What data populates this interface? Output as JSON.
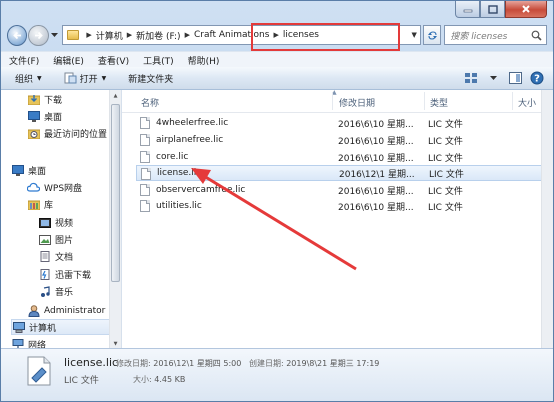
{
  "address": {
    "segments": [
      "计算机",
      "新加卷 (F:)",
      "Craft Animations",
      "licenses"
    ]
  },
  "search": {
    "placeholder": "搜索 licenses"
  },
  "menu": [
    "文件(F)",
    "编辑(E)",
    "查看(V)",
    "工具(T)",
    "帮助(H)"
  ],
  "toolbar": {
    "organize": "组织",
    "open": "打开",
    "new_folder": "新建文件夹"
  },
  "nav": {
    "favorites": [
      {
        "label": "下载",
        "icon": "download-folder-icon"
      },
      {
        "label": "桌面",
        "icon": "desktop-icon"
      },
      {
        "label": "最近访问的位置",
        "icon": "recent-places-icon"
      }
    ],
    "items": [
      {
        "label": "桌面",
        "icon": "desktop-icon"
      },
      {
        "label": "WPS网盘",
        "icon": "cloud-icon"
      },
      {
        "label": "库",
        "icon": "library-icon"
      },
      {
        "label": "视频",
        "icon": "video-library-icon"
      },
      {
        "label": "图片",
        "icon": "pictures-library-icon"
      },
      {
        "label": "文档",
        "icon": "documents-library-icon"
      },
      {
        "label": "迅雷下载",
        "icon": "thunder-download-icon"
      },
      {
        "label": "音乐",
        "icon": "music-library-icon"
      },
      {
        "label": "Administrator",
        "icon": "user-icon"
      },
      {
        "label": "计算机",
        "icon": "computer-icon"
      },
      {
        "label": "网络",
        "icon": "network-icon"
      }
    ]
  },
  "columns": {
    "name": "名称",
    "date": "修改日期",
    "type": "类型",
    "size": "大小"
  },
  "files": [
    {
      "name": "4wheelerfree.lic",
      "date": "2016\\6\\10 星期...",
      "type": "LIC 文件"
    },
    {
      "name": "airplanefree.lic",
      "date": "2016\\6\\10 星期...",
      "type": "LIC 文件"
    },
    {
      "name": "core.lic",
      "date": "2016\\6\\10 星期...",
      "type": "LIC 文件"
    },
    {
      "name": "license.lic",
      "date": "2016\\12\\1 星期...",
      "type": "LIC 文件"
    },
    {
      "name": "observercamfree.lic",
      "date": "2016\\6\\10 星期...",
      "type": "LIC 文件"
    },
    {
      "name": "utilities.lic",
      "date": "2016\\6\\10 星期...",
      "type": "LIC 文件"
    }
  ],
  "details": {
    "name": "license.lic",
    "type": "LIC 文件",
    "modified_label": "修改日期:",
    "modified": "2016\\12\\1 星期四 5:00",
    "created_label": "创建日期:",
    "created": "2019\\8\\21 星期三 17:19",
    "size_label": "大小:",
    "size": "4.45 KB"
  },
  "colors": {
    "highlight_red": "#e33a3a",
    "selection": "#dae8f8"
  }
}
